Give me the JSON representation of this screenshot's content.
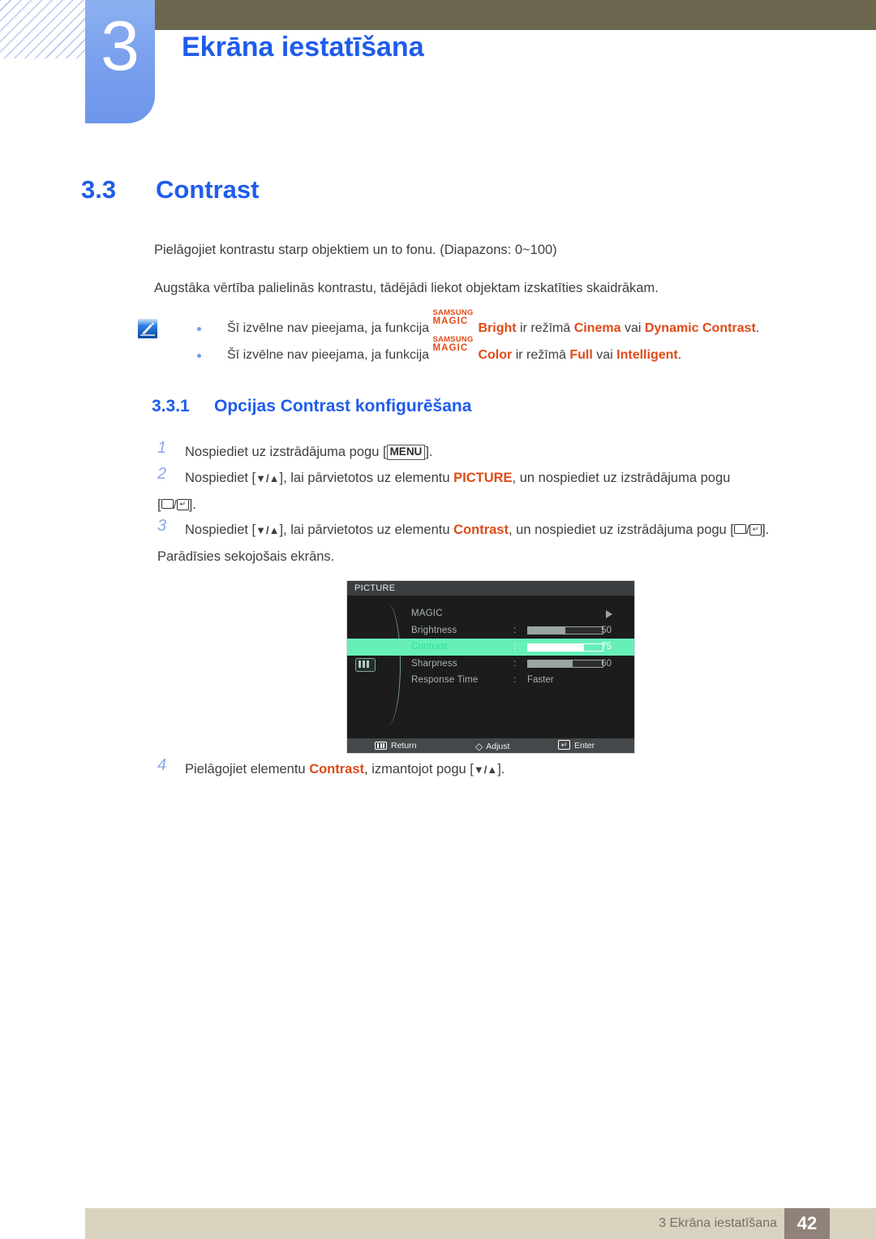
{
  "chapter": {
    "number": "3",
    "title": "Ekrāna iestatīšana"
  },
  "section": {
    "number": "3.3",
    "title": "Contrast"
  },
  "paragraphs": {
    "p1": "Pielāgojiet kontrastu starp objektiem un to fonu. (Diapazons: 0~100)",
    "p2": "Augstāka vērtība palielinās kontrastu, tādējādi liekot objektam izskatīties skaidrākam."
  },
  "note": {
    "icon": "note-pencil-icon",
    "items": [
      {
        "lead": "Šī izvēlne nav pieejama, ja funkcija ",
        "logo_top": "SAMSUNG",
        "logo_bottom": "MAGIC",
        "feature": "Bright",
        "mid": " ir režīmā ",
        "value1": "Cinema",
        "conj": " vai ",
        "value2": "Dynamic Contrast",
        "end": "."
      },
      {
        "lead": "Šī izvēlne nav pieejama, ja funkcija ",
        "logo_top": "SAMSUNG",
        "logo_bottom": "MAGIC",
        "feature": "Color",
        "mid": " ir režīmā ",
        "value1": "Full",
        "conj": " vai ",
        "value2": "Intelligent",
        "end": "."
      }
    ]
  },
  "subsection": {
    "number": "3.3.1",
    "title": "Opcijas Contrast konfigurēšana"
  },
  "steps": {
    "s1": {
      "num": "1",
      "t1": "Nospiediet uz izstrādājuma pogu [",
      "key": "MENU",
      "t2": "]."
    },
    "s2": {
      "num": "2",
      "t1": "Nospiediet [",
      "arrows": "▼/▲",
      "t2": "], lai pārvietotos uz elementu ",
      "target": "PICTURE",
      "t3": ", un nospiediet uz izstrādājuma pogu",
      "t4": "[",
      "t5": "/",
      "t6": "]."
    },
    "s3": {
      "num": "3",
      "t1": "Nospiediet [",
      "arrows": "▼/▲",
      "t2": "], lai pārvietotos uz elementu ",
      "target": "Contrast",
      "t3": ", un nospiediet uz izstrādājuma pogu [",
      "t4": "/",
      "t5": "].",
      "t6": "Parādīsies sekojošais ekrāns."
    },
    "s4": {
      "num": "4",
      "t1": "Pielāgojiet elementu ",
      "target": "Contrast",
      "t2": ", izmantojot pogu [",
      "arrows": "▼/▲",
      "t3": "]."
    }
  },
  "osd": {
    "title": "PICTURE",
    "left_icon": "picture-bars-icon",
    "rows": [
      {
        "label": "MAGIC",
        "type": "arrow",
        "colon": "",
        "value": "",
        "fill": 0
      },
      {
        "label": "Brightness",
        "type": "slider",
        "colon": ":",
        "value": "50",
        "fill": 50
      },
      {
        "label": "Contrast",
        "type": "slider",
        "colon": ":",
        "value": "75",
        "fill": 75
      },
      {
        "label": "Sharpness",
        "type": "slider",
        "colon": ":",
        "value": "60",
        "fill": 60
      },
      {
        "label": "Response Time",
        "type": "text",
        "colon": ":",
        "value": "Faster",
        "fill": 0
      }
    ],
    "selected_index": 2,
    "footer": [
      {
        "icon": "return-icon",
        "label": "Return"
      },
      {
        "icon": "adjust-diamond-icon",
        "label": "Adjust"
      },
      {
        "icon": "enter-icon",
        "label": "Enter"
      }
    ],
    "highlight_color": "#67efb9"
  },
  "footer": {
    "text": "3 Ekrāna iestatīšana",
    "page": "42"
  }
}
